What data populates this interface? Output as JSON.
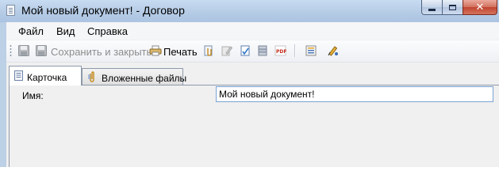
{
  "window": {
    "title": "Мой новый документ! - Договор",
    "minimize_label": "",
    "maximize_label": "",
    "close_label": "✕"
  },
  "menu": {
    "items": [
      "Файл",
      "Вид",
      "Справка"
    ]
  },
  "toolbar": {
    "save_close_label": "Сохранить и закрыть",
    "print_label": "Печать"
  },
  "tabs": [
    {
      "label": "Карточка",
      "active": true
    },
    {
      "label": "Вложенные файлы",
      "active": false
    }
  ],
  "form": {
    "name_label": "Имя:",
    "name_value": "Мой новый документ!"
  },
  "icons": {
    "app": "document-icon",
    "save": "save-icon",
    "save_close": "save-close-icon",
    "print": "print-icon",
    "attach": "attach-icon",
    "edit": "edit-icon",
    "check": "check-document-icon",
    "archive": "archive-icon",
    "pdf": "pdf-icon",
    "list": "list-icon",
    "sign": "sign-icon",
    "card_tab": "card-icon",
    "files_tab": "paperclip-icon"
  }
}
